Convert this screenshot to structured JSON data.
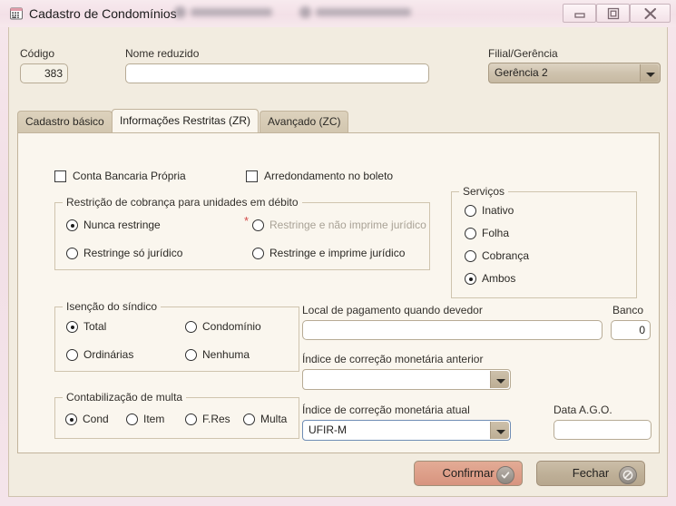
{
  "window": {
    "title": "Cadastro de Condomínios",
    "icon": "grid-app-icon",
    "controls": {
      "minimize": "minimize-icon",
      "maximize": "restore-icon",
      "close": "close-icon"
    }
  },
  "header": {
    "codigo": {
      "label": "Código",
      "value": "383"
    },
    "nome_reduzido": {
      "label": "Nome reduzido",
      "value": "",
      "placeholder": ""
    },
    "filial": {
      "label": "Filial/Gerência",
      "value": "Gerência 2"
    }
  },
  "tabs": [
    {
      "label": "Cadastro básico",
      "active": false
    },
    {
      "label": "Informações Restritas (ZR)",
      "active": true
    },
    {
      "label": "Avançado (ZC)",
      "active": false
    }
  ],
  "form": {
    "checkboxes": [
      {
        "label": "Conta Bancaria Própria",
        "checked": false
      },
      {
        "label": "Arredondamento no boleto",
        "checked": false
      }
    ],
    "restricao": {
      "title": "Restrição de cobrança para unidades em débito",
      "options": [
        {
          "label": "Nunca restringe",
          "selected": true,
          "disabled": false,
          "required": false
        },
        {
          "label": "Restringe e não imprime jurídico",
          "selected": false,
          "disabled": true,
          "required": true
        },
        {
          "label": "Restringe só jurídico",
          "selected": false,
          "disabled": false,
          "required": false
        },
        {
          "label": "Restringe e imprime jurídico",
          "selected": false,
          "disabled": false,
          "required": false
        }
      ]
    },
    "servicos": {
      "title": "Serviços",
      "options": [
        {
          "label": "Inativo",
          "selected": false
        },
        {
          "label": "Folha",
          "selected": false
        },
        {
          "label": "Cobrança",
          "selected": false
        },
        {
          "label": "Ambos",
          "selected": true
        }
      ]
    },
    "isencao": {
      "title": "Isenção do síndico",
      "options": [
        {
          "label": "Total",
          "selected": true
        },
        {
          "label": "Condomínio",
          "selected": false
        },
        {
          "label": "Ordinárias",
          "selected": false
        },
        {
          "label": "Nenhuma",
          "selected": false
        }
      ]
    },
    "contabilizacao": {
      "title": "Contabilização de multa",
      "options": [
        {
          "label": "Cond",
          "selected": true
        },
        {
          "label": "Item",
          "selected": false
        },
        {
          "label": "F.Res",
          "selected": false
        },
        {
          "label": "Multa",
          "selected": false
        }
      ]
    },
    "local_pagamento": {
      "label": "Local de pagamento quando devedor",
      "value": ""
    },
    "banco": {
      "label": "Banco",
      "value": "0"
    },
    "indice_anterior": {
      "label": "Índice de correção monetária anterior",
      "value": ""
    },
    "indice_atual": {
      "label": "Índice de correção monetária atual",
      "value": "UFIR-M"
    },
    "data_ago": {
      "label": "Data A.G.O.",
      "value": ""
    }
  },
  "footer": {
    "confirmar": {
      "label": "Confirmar",
      "icon": "check-circle-icon"
    },
    "fechar": {
      "label": "Fechar",
      "icon": "no-entry-icon"
    }
  },
  "colors": {
    "client_bg": "#f2ece0",
    "panel_bg": "#faf6ee",
    "accent_confirm": "#dd9e88",
    "accent_close": "#beaf97",
    "required_marker": "#d24a4a",
    "titlebar": "#f3e0e7"
  }
}
